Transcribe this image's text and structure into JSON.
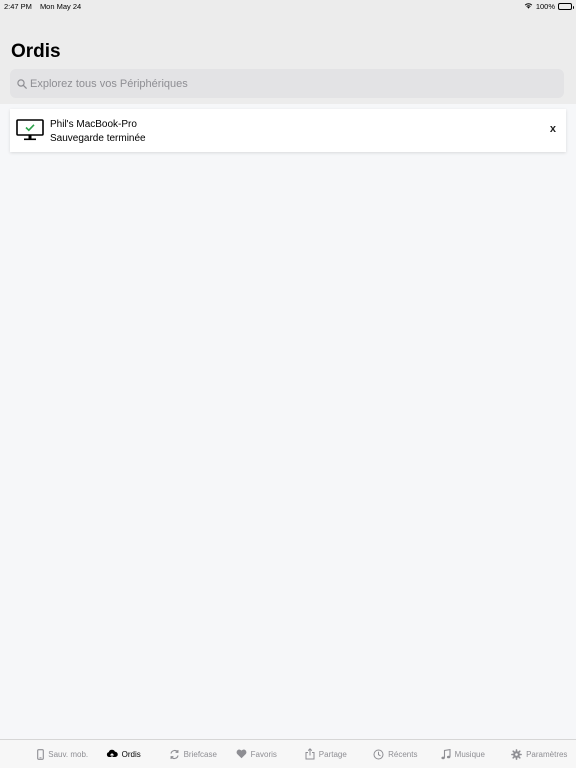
{
  "status_bar": {
    "time": "2:47 PM",
    "date": "Mon May 24",
    "battery": "100%"
  },
  "header": {
    "title": "Ordis"
  },
  "search": {
    "placeholder": "Explorez tous vos Périphériques"
  },
  "devices": [
    {
      "name": "Phil's MacBook-Pro",
      "status": "Sauvegarde terminée",
      "close_label": "x",
      "icon": "monitor-check-icon"
    }
  ],
  "tabs": [
    {
      "label": "Sauv. mob.",
      "icon": "phone-icon",
      "active": false
    },
    {
      "label": "Ordis",
      "icon": "cloud-upload-icon",
      "active": true
    },
    {
      "label": "Briefcase",
      "icon": "sync-icon",
      "active": false
    },
    {
      "label": "Favoris",
      "icon": "heart-icon",
      "active": false
    },
    {
      "label": "Partage",
      "icon": "share-icon",
      "active": false
    },
    {
      "label": "Récents",
      "icon": "clock-icon",
      "active": false
    },
    {
      "label": "Musique",
      "icon": "music-note-icon",
      "active": false
    },
    {
      "label": "Paramètres",
      "icon": "gear-icon",
      "active": false
    }
  ],
  "colors": {
    "accent": "#000000",
    "inactive": "#8e8e93",
    "check": "#2ca24a"
  }
}
